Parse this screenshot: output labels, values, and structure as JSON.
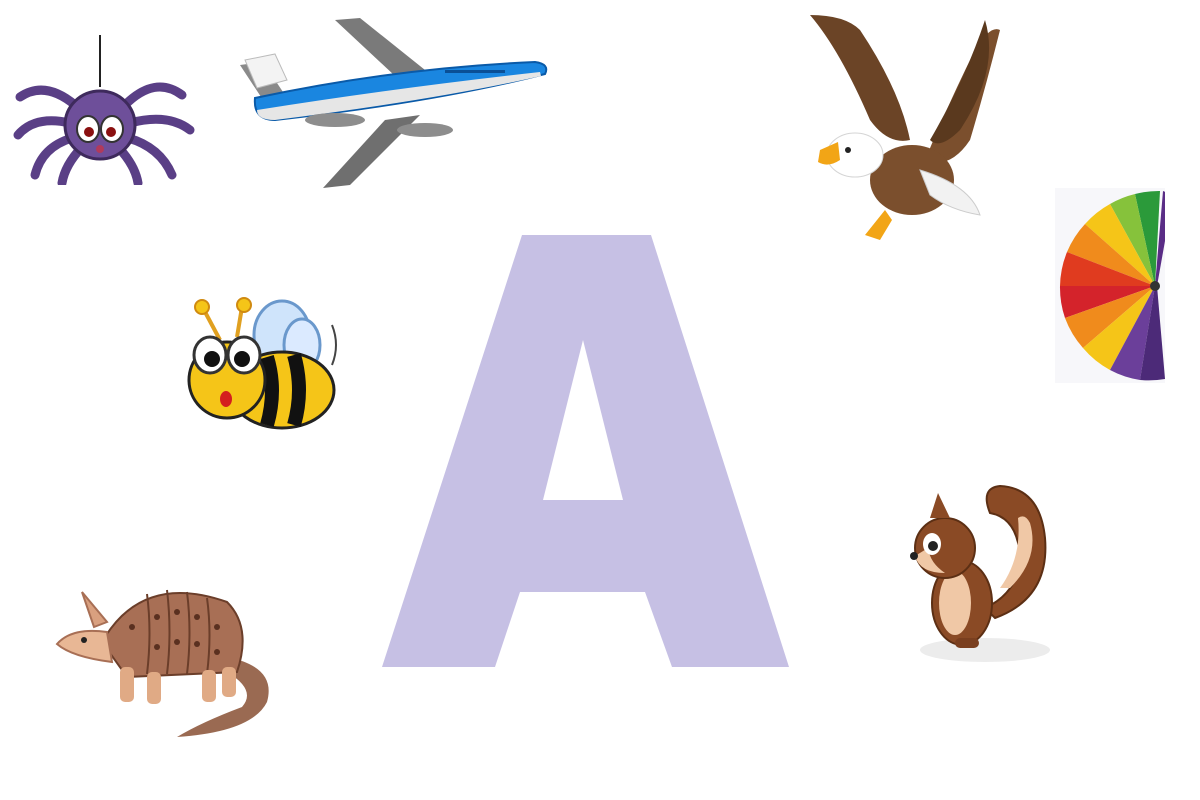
{
  "main_letter": "A",
  "colors": {
    "letter": "#c6c0e4",
    "background": "#ffffff"
  },
  "pictures": [
    {
      "name": "spider",
      "position": "top-left"
    },
    {
      "name": "airplane",
      "position": "top-left-center"
    },
    {
      "name": "eagle",
      "position": "top-right"
    },
    {
      "name": "hand-fan",
      "position": "right"
    },
    {
      "name": "bee",
      "position": "left"
    },
    {
      "name": "armadillo",
      "position": "bottom-left"
    },
    {
      "name": "squirrel",
      "position": "bottom-right"
    }
  ]
}
